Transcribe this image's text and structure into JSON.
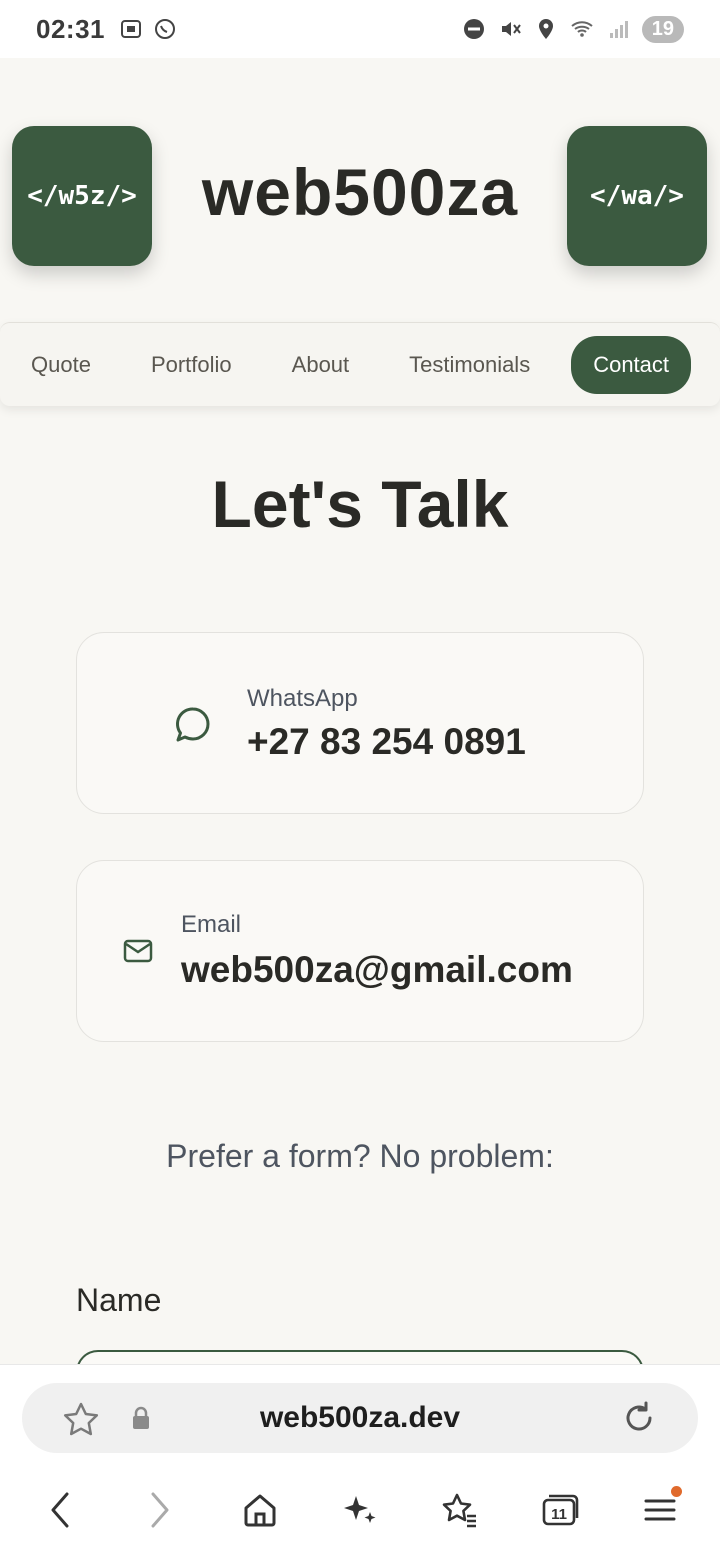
{
  "status_bar": {
    "time": "02:31",
    "battery": "19"
  },
  "header": {
    "logo_left": "</w5z/>",
    "brand": "web500za",
    "logo_right": "</wa/>"
  },
  "nav": {
    "items": [
      {
        "label": "Quote"
      },
      {
        "label": "Portfolio"
      },
      {
        "label": "About"
      },
      {
        "label": "Testimonials"
      },
      {
        "label": "Contact",
        "active": true
      }
    ]
  },
  "main": {
    "title": "Let's Talk",
    "whatsapp": {
      "label": "WhatsApp",
      "value": "+27 83 254 0891",
      "icon": "chat-bubble-icon"
    },
    "email": {
      "label": "Email",
      "value": "web500za@gmail.com",
      "icon": "mail-icon"
    },
    "prefer_text": "Prefer a form? No problem:",
    "form": {
      "name_label": "Name"
    }
  },
  "browser": {
    "url": "web500za.dev",
    "tab_count": "11"
  },
  "colors": {
    "accent": "#3b5a40",
    "background": "#f8f7f3",
    "text": "#2a2a26",
    "muted": "#4e5560"
  }
}
